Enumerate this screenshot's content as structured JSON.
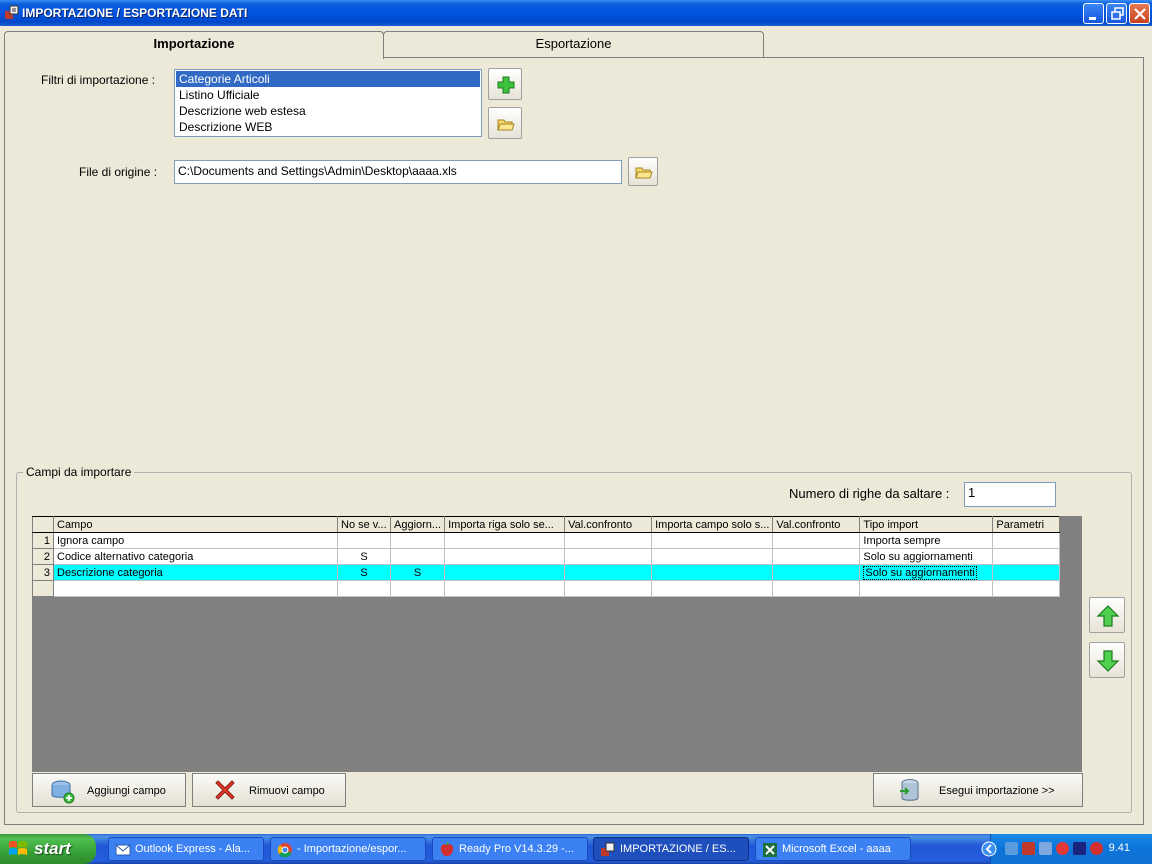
{
  "window": {
    "title": "IMPORTAZIONE / ESPORTAZIONE DATI"
  },
  "tabs": [
    {
      "label": "Importazione",
      "active": true
    },
    {
      "label": "Esportazione",
      "active": false
    }
  ],
  "filters": {
    "label": "Filtri di importazione :",
    "items": [
      {
        "label": "Categorie Articoli",
        "selected": true
      },
      {
        "label": "Listino Ufficiale",
        "selected": false
      },
      {
        "label": "Descrizione web estesa",
        "selected": false
      },
      {
        "label": "Descrizione WEB",
        "selected": false
      }
    ]
  },
  "source": {
    "label": "File di origine :",
    "value": "C:\\Documents and Settings\\Admin\\Desktop\\aaaa.xls"
  },
  "fields_group": {
    "label": "Campi da importare",
    "skip_rows_label": "Numero di righe da saltare :",
    "skip_rows_value": "1"
  },
  "grid": {
    "columns": [
      "Campo",
      "No se v...",
      "Aggiorn...",
      "Importa riga solo se...",
      "Val.confronto",
      "Importa campo solo s...",
      "Val.confronto",
      "Tipo import",
      "Parametri"
    ],
    "rows": [
      {
        "num": "1",
        "cells": [
          "Ignora campo",
          "",
          "",
          "",
          "",
          "",
          "",
          "Importa sempre",
          ""
        ]
      },
      {
        "num": "2",
        "cells": [
          "Codice alternativo categoria",
          "S",
          "",
          "",
          "",
          "",
          "",
          "Solo su aggiornamenti",
          ""
        ]
      },
      {
        "num": "3",
        "cells": [
          "Descrizione categoria",
          "S",
          "S",
          "",
          "",
          "",
          "",
          "Solo su aggiornamenti",
          ""
        ]
      }
    ]
  },
  "buttons": {
    "add_field": "Aggiungi campo",
    "remove_field": "Rimuovi campo",
    "run_import": "Esegui importazione >>"
  },
  "taskbar": {
    "start_label": "start",
    "items": [
      {
        "label": "Outlook Express - Ala...",
        "icon": "outlook-icon"
      },
      {
        "label": "- Importazione/espor...",
        "icon": "chrome-icon"
      },
      {
        "label": "Ready Pro V14.3.29 -...",
        "icon": "readypro-icon"
      },
      {
        "label": "IMPORTAZIONE / ES...",
        "icon": "app-icon",
        "active": true
      },
      {
        "label": "Microsoft Excel - aaaa",
        "icon": "excel-icon"
      }
    ],
    "clock": "9.41"
  },
  "colors": {
    "titlebar": "#0054e3",
    "selection": "#316ac5",
    "grid_highlight": "#00ffff",
    "start_green": "#37a137"
  }
}
